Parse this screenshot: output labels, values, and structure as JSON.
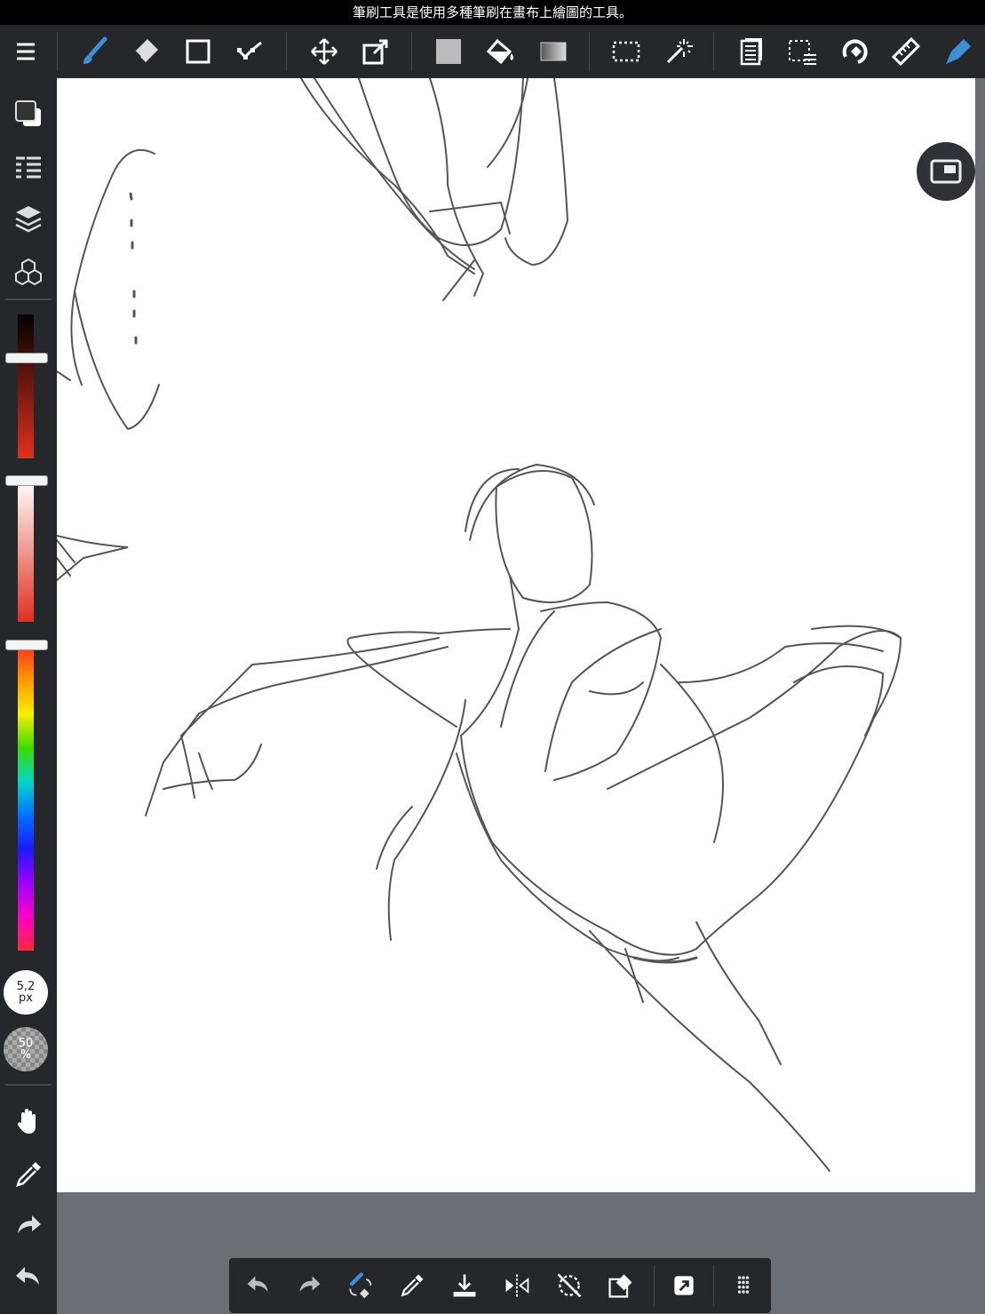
{
  "hint": {
    "text": "筆刷工具是使用多種筆刷在畫布上繪圖的工具。"
  },
  "toolbar": {
    "icons": [
      "menu-icon",
      "brush-icon",
      "eraser-icon",
      "shape-icon",
      "dot-icon",
      "move-icon",
      "transform-icon",
      "fill-color-icon",
      "bucket-icon",
      "gradient-icon",
      "select-icon",
      "magic-wand-icon",
      "layers-doc-icon",
      "select-layer-icon",
      "lasso-fill-icon",
      "ruler-icon",
      "pen-icon"
    ]
  },
  "brush": {
    "size": "5,2",
    "size_unit": "px",
    "opacity": "50",
    "opacity_unit": "%"
  },
  "colors": {
    "accent": "#3d8fd6",
    "bar": "#26272b",
    "canvas": "#ffffff",
    "background": "#6b6e73"
  },
  "color_sliders": {
    "brightness_level": 0.3,
    "saturation_level": 0.0,
    "hue_level": 0.0
  }
}
